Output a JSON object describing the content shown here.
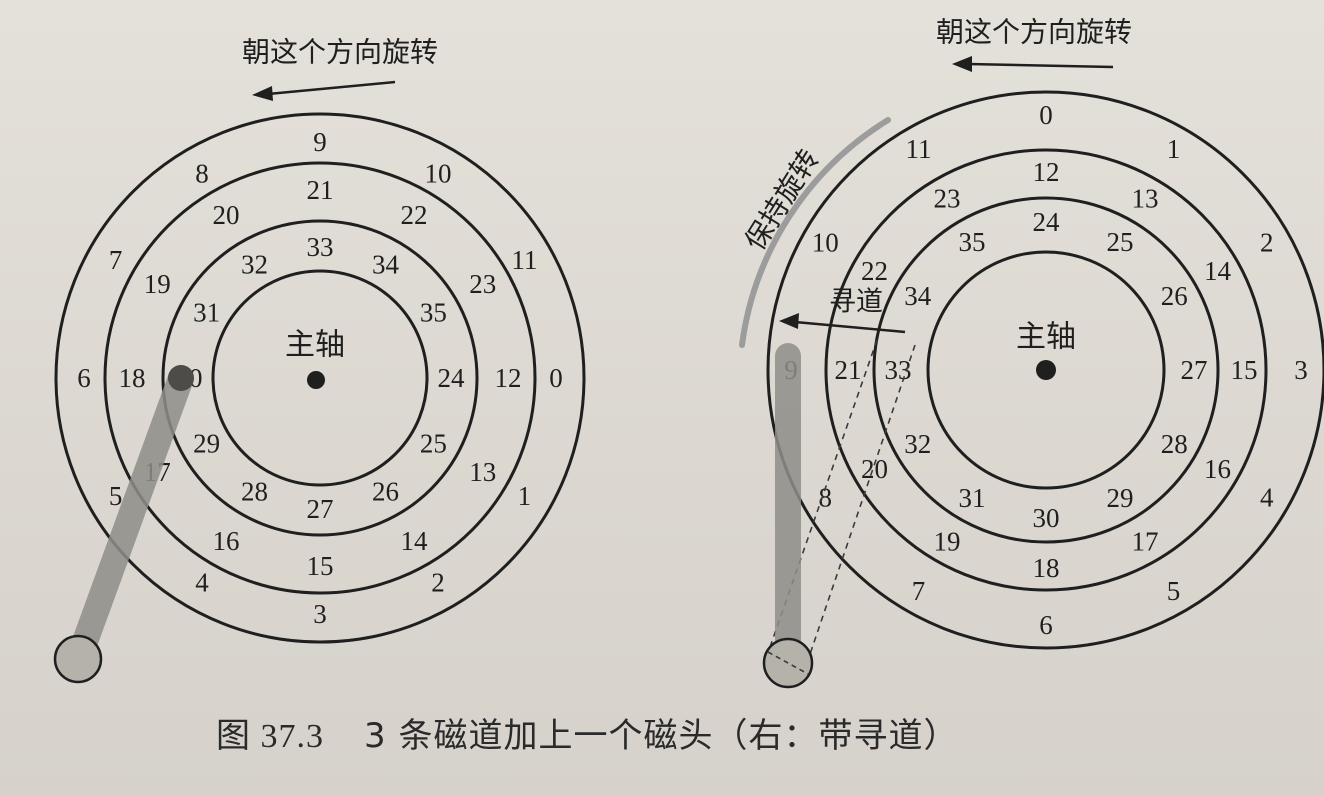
{
  "left_disk": {
    "rotation_label": "朝这个方向旋转",
    "spindle_label": "主轴",
    "outer_track": [
      "0",
      "1",
      "2",
      "3",
      "4",
      "5",
      "6",
      "7",
      "8",
      "9",
      "10",
      "11"
    ],
    "middle_track": [
      "12",
      "13",
      "14",
      "15",
      "16",
      "17",
      "18",
      "19",
      "20",
      "21",
      "22",
      "23"
    ],
    "inner_track": [
      "24",
      "25",
      "26",
      "27",
      "28",
      "29",
      "30",
      "31",
      "32",
      "33",
      "34",
      "35"
    ]
  },
  "right_disk": {
    "rotation_label": "朝这个方向旋转",
    "spindle_label": "主轴",
    "keep_rotating_label": "保持旋转",
    "seek_label": "寻道",
    "outer_track": [
      "0",
      "1",
      "2",
      "3",
      "4",
      "5",
      "6",
      "7",
      "8",
      "9",
      "10",
      "11"
    ],
    "middle_track": [
      "12",
      "13",
      "14",
      "15",
      "16",
      "17",
      "18",
      "19",
      "20",
      "21",
      "22",
      "23"
    ],
    "inner_track": [
      "24",
      "25",
      "26",
      "27",
      "28",
      "29",
      "30",
      "31",
      "32",
      "33",
      "34",
      "35"
    ]
  },
  "caption": {
    "figure_word": "图",
    "figure_number": "37.3",
    "text": "3 条磁道加上一个磁头（右：带寻道）"
  },
  "colors": {
    "ink": "#1f1f1f",
    "arm_fill": "#9a9994",
    "arc_gray": "#9c9c9c",
    "paper": "#dedad3"
  }
}
